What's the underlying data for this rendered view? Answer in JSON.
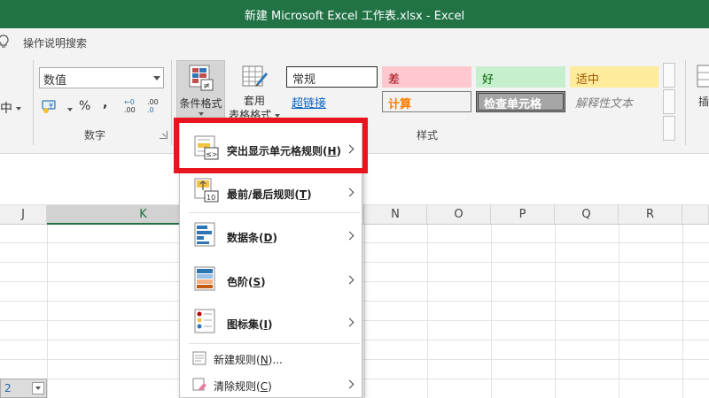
{
  "window": {
    "title": "新建 Microsoft Excel 工作表.xlsx  -  Excel"
  },
  "ribbon": {
    "tell_me": "操作说明搜索",
    "number_group": {
      "format_value": "数值",
      "label": "数字",
      "currency_symbol": "¥",
      "percent_symbol": "%",
      "comma_symbol": ",",
      "increase_decimal": ".00",
      "decrease_decimal": ".0",
      "increase_decimal_top": "←0",
      "decrease_decimal_top": ".00"
    },
    "conditional_format": {
      "line1": "条件格式",
      "icon": "≠"
    },
    "format_as_table": {
      "line1": "套用",
      "line2": "表格格式"
    },
    "styles": {
      "label": "样式",
      "normal": "常规",
      "bad": "差",
      "good": "好",
      "neutral": "适中",
      "hyperlink": "超链接",
      "calculation": "计算",
      "check_cell": "检查单元格",
      "explanatory": "解释性文本"
    },
    "insert_partial": "插",
    "align_partial": "中"
  },
  "grid": {
    "columns": [
      "J",
      "K",
      "N",
      "O",
      "P",
      "Q",
      "R"
    ],
    "selected_column": "K",
    "active_cell_value": "2"
  },
  "menu": {
    "items": [
      {
        "label": "突出显示单元格规则(",
        "key": "H",
        "suffix": ")",
        "icon": "highlight-cells-rules-icon",
        "icon_text": "≤>"
      },
      {
        "label": "最前/最后规则(",
        "key": "T",
        "suffix": ")",
        "icon": "top-bottom-rules-icon",
        "icon_text": "10"
      },
      {
        "label": "数据条(",
        "key": "D",
        "suffix": ")",
        "icon": "data-bars-icon"
      },
      {
        "label": "色阶(",
        "key": "S",
        "suffix": ")",
        "icon": "color-scales-icon"
      },
      {
        "label": "图标集(",
        "key": "I",
        "suffix": ")",
        "icon": "icon-sets-icon"
      }
    ],
    "new_rule": {
      "label": "新建规则(",
      "key": "N",
      "suffix": ")..."
    },
    "clear_rules": {
      "label": "清除规则(",
      "key": "C",
      "suffix": ")"
    }
  },
  "colors": {
    "title_bar": "#217346",
    "highlight_border": "#e8141e"
  }
}
